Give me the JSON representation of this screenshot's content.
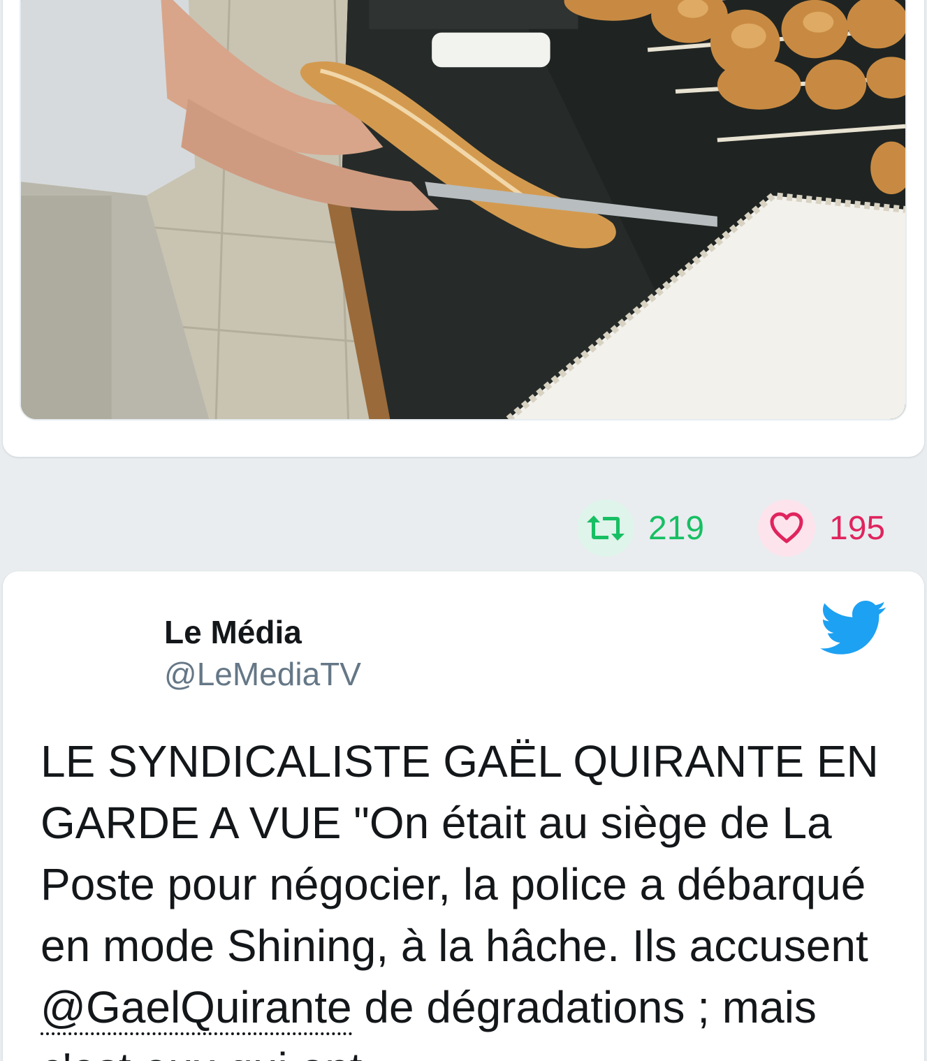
{
  "photo": {
    "subject": "baker-cutting-baguette"
  },
  "actions": {
    "retweet_count": "219",
    "like_count": "195"
  },
  "tweet": {
    "author_name": "Le Média",
    "author_handle": "@LeMediaTV",
    "text_before_mention": "LE SYNDICALISTE GAËL QUIRANTE EN GARDE A VUE \"On était au siège de La Poste pour négocier, la police a débarqué en mode Shining, à la hâche. Ils accusent ",
    "mention": "@GaelQuirante",
    "text_after_mention": " de dégradations ; mais c'est eux qui ont"
  },
  "icons": {
    "retweet": "retweet-icon",
    "like": "heart-icon",
    "brand": "twitter-bird-icon"
  },
  "colors": {
    "retweet": "#17bf63",
    "like": "#e0245e",
    "twitter_blue": "#1da1f2",
    "handle": "#657786",
    "background": "#e9edf0"
  }
}
